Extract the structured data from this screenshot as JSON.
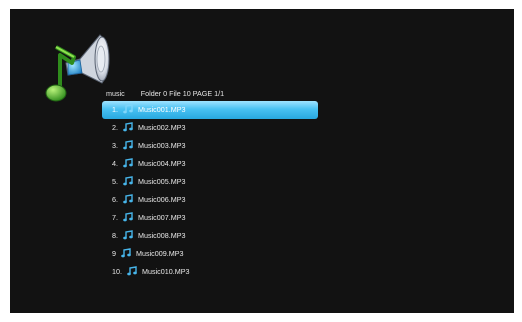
{
  "header": {
    "folder_name": "music",
    "info": "Folder 0 File 10 PAGE 1/1"
  },
  "files": [
    {
      "index": "1.",
      "name": "Music001.MP3",
      "selected": true
    },
    {
      "index": "2.",
      "name": "Music002.MP3",
      "selected": false
    },
    {
      "index": "3.",
      "name": "Music003.MP3",
      "selected": false
    },
    {
      "index": "4.",
      "name": "Music004.MP3",
      "selected": false
    },
    {
      "index": "5.",
      "name": "Music005.MP3",
      "selected": false
    },
    {
      "index": "6.",
      "name": "Music006.MP3",
      "selected": false
    },
    {
      "index": "7.",
      "name": "Music007.MP3",
      "selected": false
    },
    {
      "index": "8.",
      "name": "Music008.MP3",
      "selected": false
    },
    {
      "index": "9",
      "name": "Music009.MP3",
      "selected": false
    },
    {
      "index": "10.",
      "name": "Music010.MP3",
      "selected": false
    }
  ],
  "icons": {
    "logo": "music-speaker-icon",
    "file": "music-note-icon"
  },
  "colors": {
    "background": "#121212",
    "selection": "#3cb8ee",
    "note_icon": "#47b5ea"
  }
}
